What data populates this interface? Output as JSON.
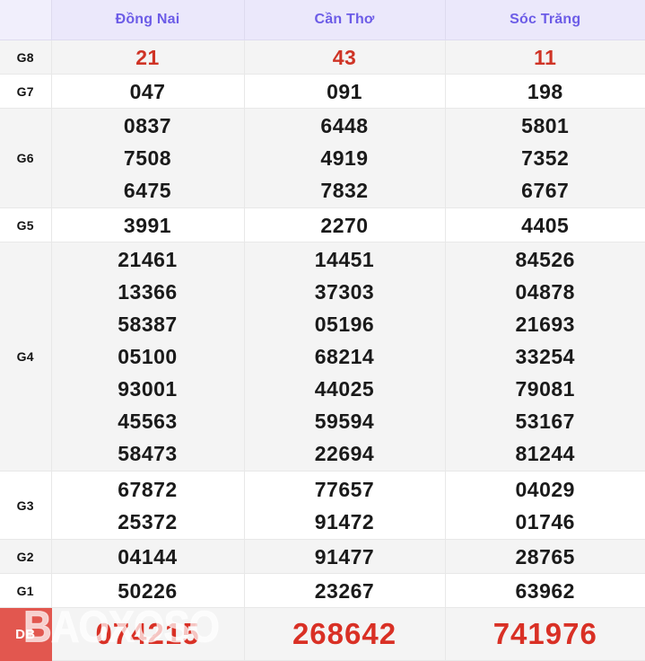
{
  "table": {
    "corner_label": "",
    "columns": [
      {
        "id": "dong-nai",
        "name": "Đồng Nai"
      },
      {
        "id": "can-tho",
        "name": "Cần Thơ"
      },
      {
        "id": "soc-trang",
        "name": "Sóc Trăng"
      }
    ],
    "header_color": "#6c5ce7",
    "header_bg": "#ebe8fb",
    "accent_red": "#cf3426",
    "special_red": "#d93025",
    "special_label_bg": "#e2574f",
    "stripe_gray": "#f4f4f4",
    "stripe_white": "#ffffff",
    "rows": [
      {
        "label": "G8",
        "dong_nai": [
          "21"
        ],
        "can_tho": [
          "43"
        ],
        "soc_trang": [
          "11"
        ]
      },
      {
        "label": "G7",
        "dong_nai": [
          "047"
        ],
        "can_tho": [
          "091"
        ],
        "soc_trang": [
          "198"
        ]
      },
      {
        "label": "G6",
        "dong_nai": [
          "0837",
          "7508",
          "6475"
        ],
        "can_tho": [
          "6448",
          "4919",
          "7832"
        ],
        "soc_trang": [
          "5801",
          "7352",
          "6767"
        ]
      },
      {
        "label": "G5",
        "dong_nai": [
          "3991"
        ],
        "can_tho": [
          "2270"
        ],
        "soc_trang": [
          "4405"
        ]
      },
      {
        "label": "G4",
        "dong_nai": [
          "21461",
          "13366",
          "58387",
          "05100",
          "93001",
          "45563",
          "58473"
        ],
        "can_tho": [
          "14451",
          "37303",
          "05196",
          "68214",
          "44025",
          "59594",
          "22694"
        ],
        "soc_trang": [
          "84526",
          "04878",
          "21693",
          "33254",
          "79081",
          "53167",
          "81244"
        ]
      },
      {
        "label": "G3",
        "dong_nai": [
          "67872",
          "25372"
        ],
        "can_tho": [
          "77657",
          "91472"
        ],
        "soc_trang": [
          "04029",
          "01746"
        ]
      },
      {
        "label": "G2",
        "dong_nai": [
          "04144"
        ],
        "can_tho": [
          "91477"
        ],
        "soc_trang": [
          "28765"
        ]
      },
      {
        "label": "G1",
        "dong_nai": [
          "50226"
        ],
        "can_tho": [
          "23267"
        ],
        "soc_trang": [
          "63962"
        ]
      },
      {
        "label": "DB",
        "dong_nai": [
          "074215"
        ],
        "can_tho": [
          "268642"
        ],
        "soc_trang": [
          "741976"
        ]
      }
    ]
  },
  "watermark": {
    "line1": "DB",
    "line2": "BAOXOSO"
  }
}
